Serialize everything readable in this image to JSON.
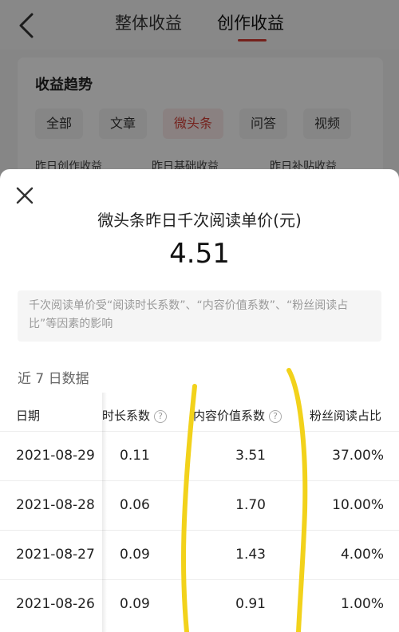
{
  "header": {
    "tabs": [
      {
        "label": "整体收益"
      },
      {
        "label": "创作收益"
      }
    ]
  },
  "earnings_card": {
    "title": "收益趋势",
    "filters": [
      {
        "label": "全部"
      },
      {
        "label": "文章"
      },
      {
        "label": "微头条"
      },
      {
        "label": "问答"
      },
      {
        "label": "视频"
      }
    ],
    "stats": [
      {
        "label": "昨日创作收益"
      },
      {
        "label": "昨日基础收益"
      },
      {
        "label": "昨日补贴收益"
      }
    ]
  },
  "modal": {
    "title": "微头条昨日千次阅读单价(元)",
    "value": "4.51",
    "note": "千次阅读单价受“阅读时长系数”、“内容价值系数”、“粉丝阅读占比”等因素的影响",
    "period": "近 7 日数据",
    "help_glyph": "?",
    "columns": {
      "date": "日期",
      "duration": "时长系数",
      "quality": "内容价值系数",
      "fans": "粉丝阅读占比"
    },
    "rows": [
      {
        "date": "2021-08-29",
        "duration": "0.11",
        "quality": "3.51",
        "fans": "37.00%"
      },
      {
        "date": "2021-08-28",
        "duration": "0.06",
        "quality": "1.70",
        "fans": "10.00%"
      },
      {
        "date": "2021-08-27",
        "duration": "0.09",
        "quality": "1.43",
        "fans": "4.00%"
      },
      {
        "date": "2021-08-26",
        "duration": "0.09",
        "quality": "0.91",
        "fans": "1.00%"
      }
    ]
  },
  "colors": {
    "accent": "#d43c33",
    "highlight_marker": "#f2d21b"
  }
}
